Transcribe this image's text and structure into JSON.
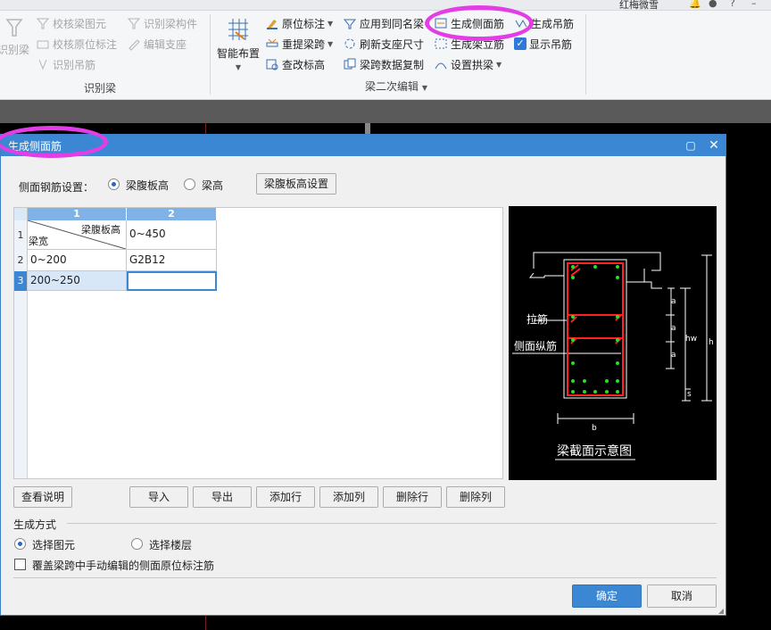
{
  "ribbon": {
    "top_user": "红梅微雪",
    "left_big": "识别梁",
    "group1": {
      "items": [
        "校核梁图元",
        "校核原位标注",
        "识别吊筋",
        "识别梁构件",
        "编辑支座"
      ],
      "label": "识别梁"
    },
    "smart_layout": "智能布置",
    "group2": {
      "items": [
        "原位标注",
        "重提梁跨",
        "查改标高",
        "应用到同名梁",
        "刷新支座尺寸",
        "梁跨数据复制",
        "生成侧面筋",
        "生成架立筋",
        "设置拱梁",
        "生成吊筋",
        "显示吊筋"
      ],
      "label": "梁二次编辑"
    }
  },
  "dialog": {
    "title": "生成侧面筋",
    "setting_label": "侧面钢筋设置：",
    "radio_web_height": "梁腹板高",
    "radio_beam_height": "梁高",
    "web_height_settings_btn": "梁腹板高设置",
    "grid": {
      "col_headers": [
        "1",
        "2"
      ],
      "row_headers": [
        "1",
        "2",
        "3"
      ],
      "corner_top": "梁腹板高",
      "corner_bottom": "梁宽",
      "r1c2": "0~450",
      "r2c1": "0~200",
      "r2c2": "G2B12",
      "r3c1": "200~250",
      "r3c2": ""
    },
    "diagram": {
      "caption": "梁截面示意图",
      "label_tie": "拉筋",
      "label_side_long": "侧面纵筋",
      "a1": "a",
      "a2": "a",
      "a3": "a",
      "hw": "hw",
      "h": "h",
      "s": "s",
      "b": "b"
    },
    "buttons": {
      "view_desc": "查看说明",
      "import": "导入",
      "export": "导出",
      "add_row": "添加行",
      "add_col": "添加列",
      "del_row": "删除行",
      "del_col": "删除列",
      "ok": "确定",
      "cancel": "取消"
    },
    "gen_method_label": "生成方式",
    "radio_select_element": "选择图元",
    "radio_select_floor": "选择楼层",
    "checkbox_override": "覆盖梁跨中手动编辑的侧面原位标注筋"
  }
}
